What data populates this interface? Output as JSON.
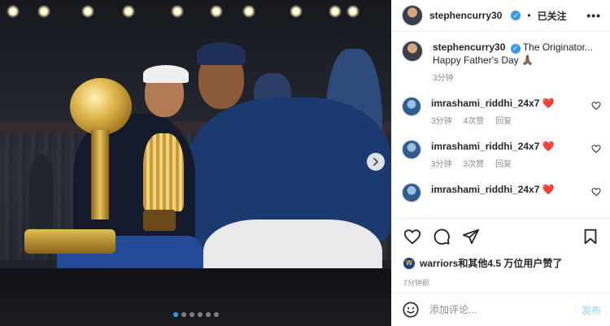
{
  "post": {
    "author": "stephencurry30",
    "follow_state": "已关注",
    "separator": "•",
    "more_menu": "•••",
    "carousel": {
      "total_slides": 6,
      "active_slide": 0
    }
  },
  "caption": {
    "username": "stephencurry30",
    "text_line1": "The Originator...",
    "text_line2": "Happy Father's Day 🙏🏾",
    "time": "3分钟"
  },
  "comments": [
    {
      "username": "imrashami_riddhi_24x7",
      "text": "❤️",
      "time": "3分钟",
      "likes": "4次赞",
      "reply": "回复"
    },
    {
      "username": "imrashami_riddhi_24x7",
      "text": "❤️",
      "time": "3分钟",
      "likes": "3次赞",
      "reply": "回复"
    },
    {
      "username": "imrashami_riddhi_24x7",
      "text": "❤️"
    }
  ],
  "likes": {
    "logo_text": "W",
    "user": "warriors",
    "rest": "和其他4.5 万位用户赞了"
  },
  "timestamp": "7分钟前",
  "composer": {
    "placeholder": "添加评论...",
    "post_label": "发布"
  },
  "icons": {
    "like": "heart-icon",
    "comment": "comment-icon",
    "share": "paper-plane-icon",
    "save": "bookmark-icon",
    "emoji": "emoji-icon",
    "next": "chevron-right-icon",
    "verified": "verified-badge-icon"
  },
  "colors": {
    "verified_blue": "#3897f0",
    "heart_red": "#ed4956",
    "muted_text": "#8e8e8e",
    "post_button_disabled": "#b2dffc"
  }
}
